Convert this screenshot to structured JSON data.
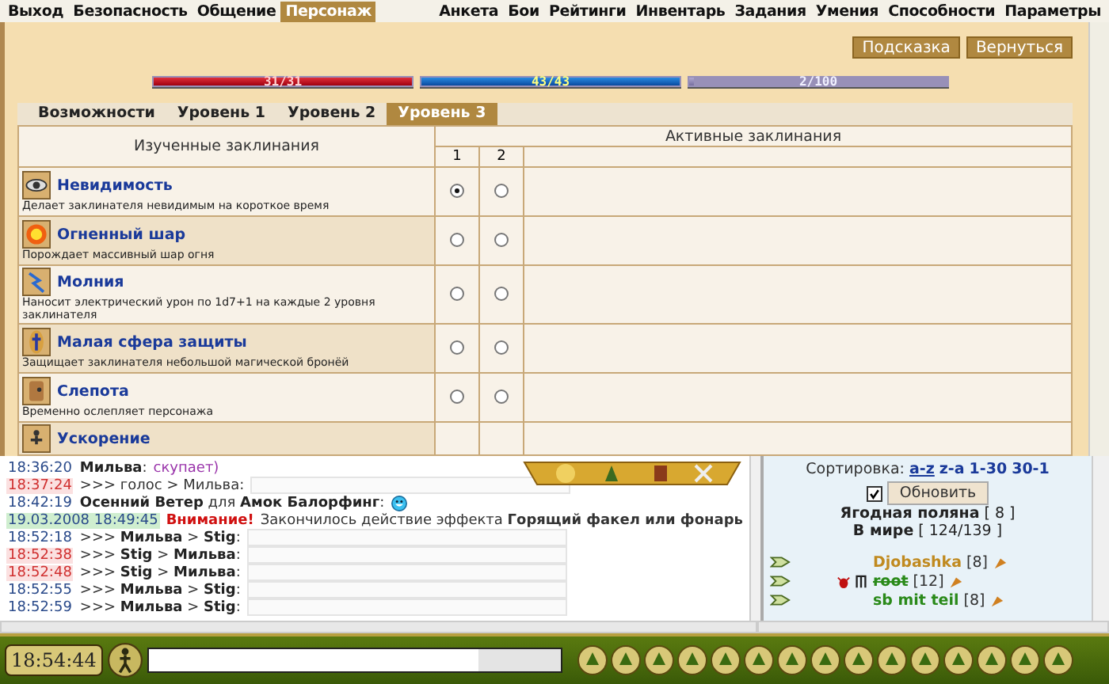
{
  "menu": {
    "left": [
      {
        "label": "Выход",
        "selected": false
      },
      {
        "label": "Безопасность",
        "selected": false
      },
      {
        "label": "Общение",
        "selected": false
      },
      {
        "label": "Персонаж",
        "selected": true
      }
    ],
    "right": [
      {
        "label": "Анкета",
        "selected": false
      },
      {
        "label": "Бои",
        "selected": false
      },
      {
        "label": "Рейтинги",
        "selected": false
      },
      {
        "label": "Инвентарь",
        "selected": false
      },
      {
        "label": "Задания",
        "selected": false
      },
      {
        "label": "Умения",
        "selected": false
      },
      {
        "label": "Способности",
        "selected": false
      },
      {
        "label": "Параметры",
        "selected": false
      }
    ]
  },
  "buttons": [
    "Подсказка",
    "Вернуться"
  ],
  "bars": [
    {
      "kind": "health",
      "reading": "31/31",
      "level": 1
    },
    {
      "kind": "mana",
      "reading": "43/43",
      "level": 1
    },
    {
      "kind": "experience",
      "reading": "2/100",
      "level": 0.02
    }
  ],
  "tabs": [
    {
      "label": "Возможности",
      "selected": false
    },
    {
      "label": "Уровень 1",
      "selected": false
    },
    {
      "label": "Уровень 2",
      "selected": false
    },
    {
      "label": "Уровень 3",
      "selected": true
    }
  ],
  "table": {
    "learned_header": "Изученные заклинания",
    "active_header": "Активные заклинания",
    "slot_headers": [
      "1",
      "2"
    ],
    "spells": [
      {
        "kind": "eye",
        "name": "Невидимость",
        "description": "Делает заклинателя невидимым на короткое время",
        "slots": [
          {
            "selected": true
          },
          {
            "selected": false
          }
        ]
      },
      {
        "kind": "fire",
        "name": "Огненный шар",
        "description": "Порождает массивный шар огня",
        "slots": [
          {
            "selected": false
          },
          {
            "selected": false
          }
        ]
      },
      {
        "kind": "lightning",
        "name": "Молния",
        "description": "Наносит электрический урон по 1d7+1 на каждые 2 уровня заклинателя",
        "slots": [
          {
            "selected": false
          },
          {
            "selected": false
          }
        ]
      },
      {
        "kind": "shield",
        "name": "Малая сфера защиты",
        "description": "Защищает заклинателя небольшой магической бронёй",
        "slots": [
          {
            "selected": false
          },
          {
            "selected": false
          }
        ]
      },
      {
        "kind": "blind",
        "name": "Слепота",
        "description": "Временно ослепляет персонажа",
        "slots": [
          {
            "selected": false
          },
          {
            "selected": false
          }
        ]
      },
      {
        "kind": "haste",
        "name": "Ускорение"
      }
    ]
  },
  "chat": [
    {
      "time": "18:36:20",
      "kind": "public",
      "text": "**Мильва**:",
      "message": "скупает)"
    },
    {
      "time": "18:37:24",
      "kind": "private_in",
      "text": ">>> голос > Мильва:",
      "redacted": true
    },
    {
      "time": "18:42:19",
      "kind": "public",
      "text": "**Осенний Ветер** для **Амок Балорфинг**:",
      "smiley": true
    },
    {
      "time": "19.03.2008 18:49:45",
      "kind": "system",
      "text": "Внимание!",
      "message": "Закончилось действие эффекта **Горящий факел или фонарь**"
    },
    {
      "time": "18:52:18",
      "kind": "private_out",
      "text": ">>> **Мильва** > **Stig**:",
      "redacted": true
    },
    {
      "time": "18:52:38",
      "kind": "private_in",
      "text": ">>> **Stig** > **Мильва**:",
      "redacted": true
    },
    {
      "time": "18:52:48",
      "kind": "private_in",
      "text": ">>> **Stig** > **Мильва**:",
      "redacted": true
    },
    {
      "time": "18:52:55",
      "kind": "private_out",
      "text": ">>> **Мильва** > **Stig**:",
      "redacted": true
    },
    {
      "time": "18:52:59",
      "kind": "private_out",
      "text": ">>> **Мильва** > **Stig**:",
      "redacted": true
    }
  ],
  "players": {
    "sort_label": "Сортировка:",
    "sort_options": [
      {
        "label": "a-z",
        "selected": true
      },
      {
        "label": "z-a",
        "selected": false
      },
      {
        "label": "1-30",
        "selected": false
      },
      {
        "label": "30-1",
        "selected": false
      }
    ],
    "auto_refresh": {
      "checked": true
    },
    "refresh_button": "Обновить",
    "location": {
      "name": "Ягодная поляна",
      "count": "[ 8 ]"
    },
    "world": {
      "name": "В мире",
      "count": "[ 124/139 ]"
    },
    "list": [
      {
        "name": "Djobashka",
        "level": "[8]",
        "color": "#c08a20",
        "struck": false,
        "badges": false
      },
      {
        "name": "root",
        "level": "[12]",
        "color": "#2a8a1a",
        "struck": true,
        "badges": true
      },
      {
        "name": "sb mit teil",
        "level": "[8]",
        "color": "#2a8a1a",
        "struck": false,
        "badges": false
      }
    ]
  },
  "bottom": {
    "clock": "18:54:44"
  }
}
